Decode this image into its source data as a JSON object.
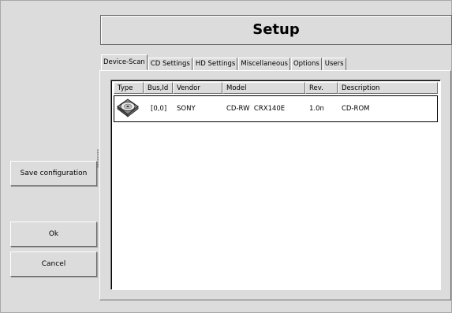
{
  "window": {
    "title": "Setup"
  },
  "sidebar": {
    "save_label": "Save configuration",
    "ok_label": "Ok",
    "cancel_label": "Cancel"
  },
  "tabs": [
    {
      "label": "Device-Scan",
      "active": true
    },
    {
      "label": "CD Settings",
      "active": false
    },
    {
      "label": "HD Settings",
      "active": false
    },
    {
      "label": "Miscellaneous",
      "active": false
    },
    {
      "label": "Options",
      "active": false
    },
    {
      "label": "Users",
      "active": false
    }
  ],
  "devices_table": {
    "columns": [
      "Type",
      "Bus,Id",
      "Vendor",
      "Model",
      "Rev.",
      "Description"
    ],
    "rows": [
      {
        "type_icon": "cdrom-drive-icon",
        "bus_id": "[0,0]",
        "vendor": "SONY",
        "model": "CD-RW  CRX140E",
        "rev": "1.0n",
        "description": "CD-ROM"
      }
    ]
  }
}
